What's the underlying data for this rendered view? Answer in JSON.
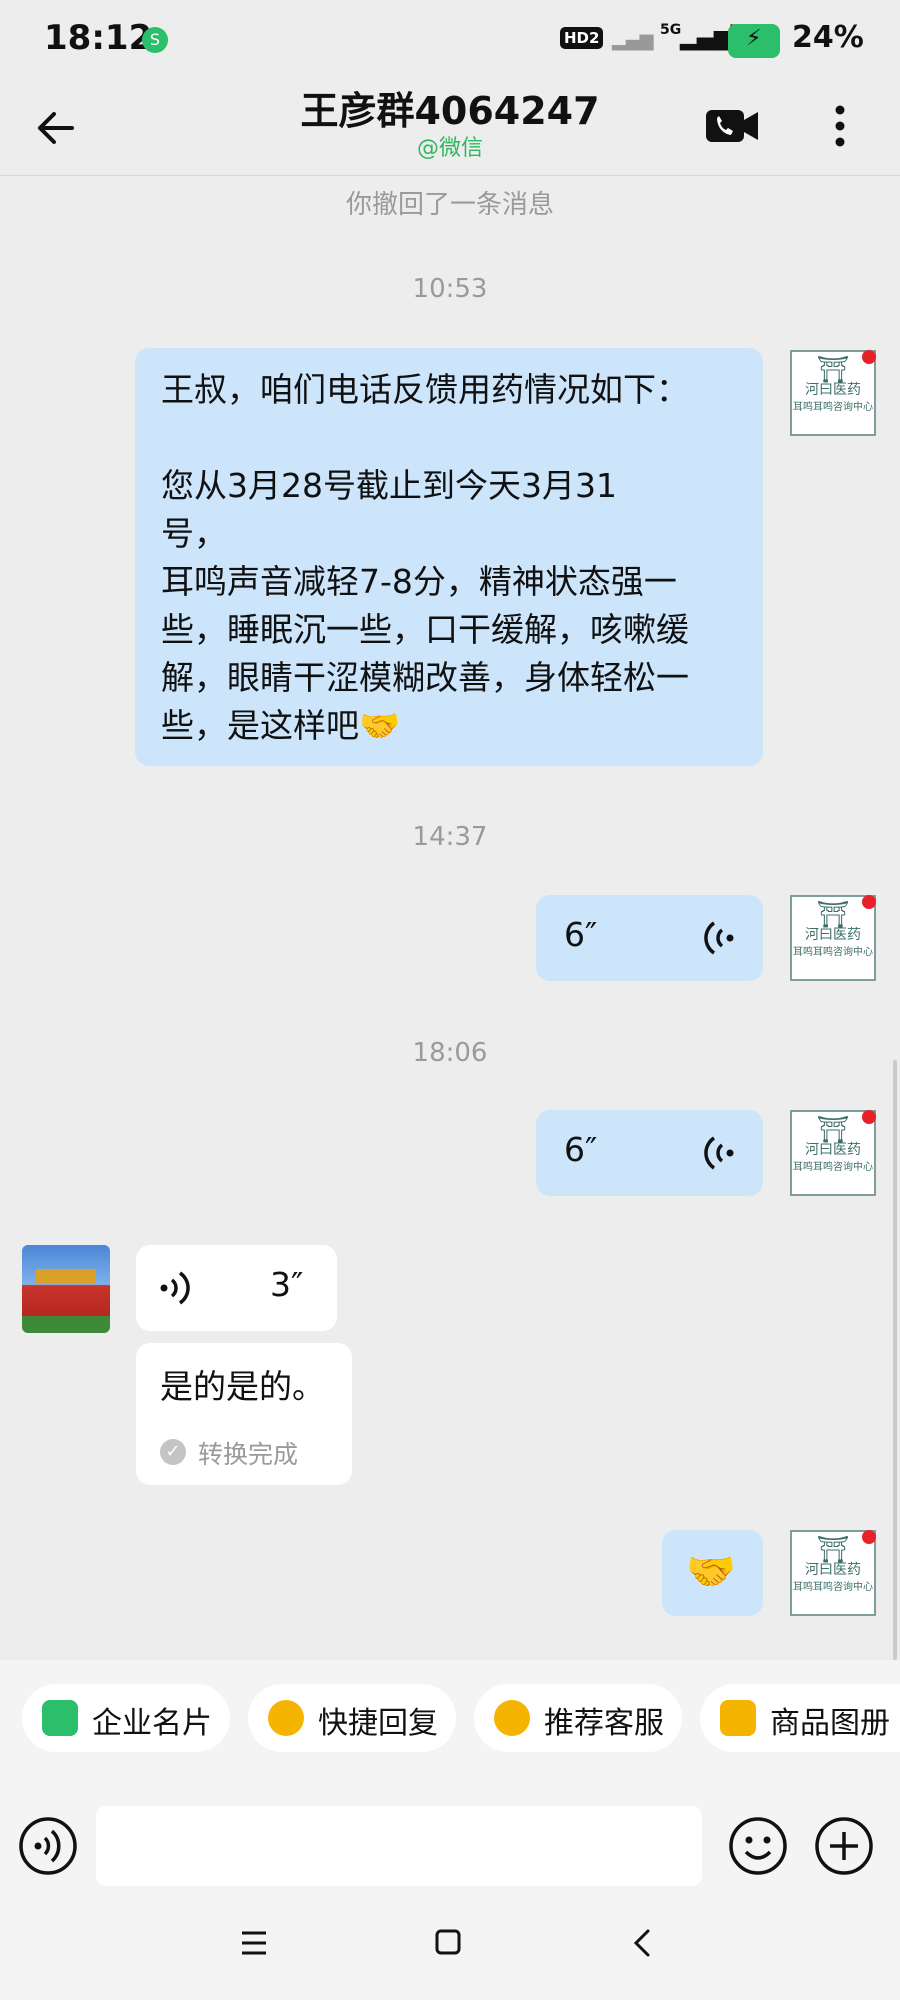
{
  "status_bar": {
    "time": "18:12",
    "network_badge": "HD2",
    "signal": "5G",
    "battery": "24%"
  },
  "header": {
    "title": "王彦群4064247",
    "subtitle": "@微信"
  },
  "avatar_logo": {
    "line1": "河曰医药",
    "line2": "耳鸣耳鸣咨询中心"
  },
  "chat": {
    "recalled_notice": "你撤回了一条消息",
    "ts1": "10:53",
    "msg1": "王叔，咱们电话反馈用药情况如下：\n\n您从3月28号截止到今天3月31\n号，\n耳鸣声音减轻7-8分，精神状态强一\n些，睡眠沉一些，口干缓解，咳嗽缓\n解，眼睛干涩模糊改善，身体轻松一\n些，是这样吧🤝",
    "ts2": "14:37",
    "voice1_len": "6″",
    "ts3": "18:06",
    "voice2_len": "6″",
    "voice3_len": "3″",
    "transcript": "是的是的。",
    "transcript_status": "转换完成",
    "emoji_msg": "🤝"
  },
  "quick_actions": [
    {
      "label": "企业名片",
      "icon": "business-card-icon",
      "color": "#2bbf6b"
    },
    {
      "label": "快捷回复",
      "icon": "quick-reply-icon",
      "color": "#f5b400"
    },
    {
      "label": "推荐客服",
      "icon": "support-icon",
      "color": "#f5b400"
    },
    {
      "label": "商品图册",
      "icon": "catalog-icon",
      "color": "#f5b400"
    }
  ],
  "colors": {
    "outgoing_bubble": "#cce5fb",
    "accent_green": "#2fb660"
  }
}
